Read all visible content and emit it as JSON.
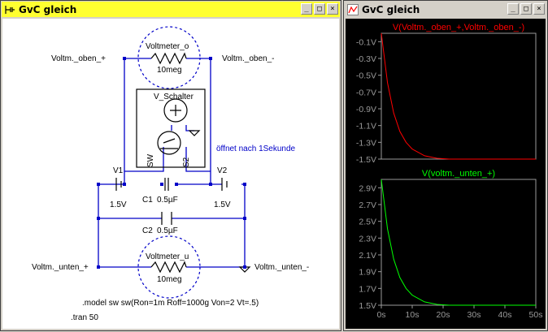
{
  "schematic_window": {
    "title": "GvC gleich",
    "icon": "schematic-icon",
    "buttons": {
      "minimize": "_",
      "maximize": "□",
      "close": "×"
    }
  },
  "plot_window": {
    "title": "GvC gleich",
    "icon": "waveform-icon",
    "buttons": {
      "minimize": "_",
      "maximize": "□",
      "close": "×"
    }
  },
  "schematic": {
    "net_labels": {
      "oben_plus": "Voltm._oben_+",
      "oben_minus": "Voltm._oben_-",
      "unten_plus": "Voltm._unten_+",
      "unten_minus": "Voltm._unten_-"
    },
    "voltmeter_oben": {
      "name": "Voltmeter_o",
      "value": "10meg"
    },
    "voltmeter_unten": {
      "name": "Voltmeter_u",
      "value": "10meg"
    },
    "switch": {
      "name": "V_Schalter",
      "sw": "SW",
      "s2": "S2",
      "note": "öffnet nach 1Sekunde"
    },
    "v1": {
      "name": "V1",
      "value": "1.5V"
    },
    "v2": {
      "name": "V2",
      "value": "1.5V"
    },
    "c1": {
      "name": "C1",
      "value": "0.5µF"
    },
    "c2": {
      "name": "C2",
      "value": "0.5µF"
    },
    "directives": {
      "model": ".model sw sw(Ron=1m Roff=1000g Von=2 Vt=.5)",
      "tran": ".tran 50"
    },
    "colors": {
      "wire": "#0000c8",
      "component": "#000000",
      "note": "#0000c8"
    }
  },
  "chart_data": [
    {
      "type": "line",
      "title": "V(Voltm._oben_+,Voltm._oben_-)",
      "title_color": "#ff0000",
      "series": [
        {
          "name": "V(Voltm._oben_+,Voltm._oben_-)",
          "color": "#ff0000",
          "x": [
            0,
            2,
            4,
            6,
            8,
            10,
            14,
            18,
            22,
            26,
            30,
            40,
            50
          ],
          "values": [
            0.0,
            -0.59,
            -0.95,
            -1.17,
            -1.3,
            -1.38,
            -1.46,
            -1.49,
            -1.5,
            -1.5,
            -1.5,
            -1.5,
            -1.5
          ]
        }
      ],
      "yticks": [
        "-0.1V",
        "-0.3V",
        "-0.5V",
        "-0.7V",
        "-0.9V",
        "-1.1V",
        "-1.3V",
        "-1.5V"
      ],
      "ylim": [
        -1.5,
        0.0
      ],
      "xlim": [
        0,
        50
      ],
      "grid": false
    },
    {
      "type": "line",
      "title": "V(voltm._unten_+)",
      "title_color": "#00ff00",
      "series": [
        {
          "name": "V(voltm._unten_+)",
          "color": "#00ff00",
          "x": [
            0,
            2,
            4,
            6,
            8,
            10,
            14,
            18,
            22,
            26,
            30,
            40,
            50
          ],
          "values": [
            3.0,
            2.41,
            2.05,
            1.83,
            1.7,
            1.62,
            1.54,
            1.51,
            1.5,
            1.5,
            1.5,
            1.5,
            1.5
          ]
        }
      ],
      "yticks": [
        "2.9V",
        "2.7V",
        "2.5V",
        "2.3V",
        "2.1V",
        "1.9V",
        "1.7V",
        "1.5V"
      ],
      "xticks": [
        "0s",
        "10s",
        "20s",
        "30s",
        "40s",
        "50s"
      ],
      "ylim": [
        1.5,
        3.0
      ],
      "xlim": [
        0,
        50
      ],
      "grid": false
    }
  ]
}
